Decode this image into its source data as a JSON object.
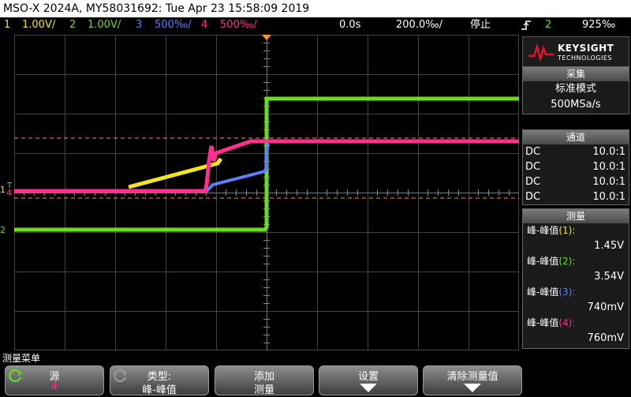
{
  "title": "MSO-X 2024A, MY58031692: Tue Apr 23 15:58:09 2019",
  "channels": {
    "ch1_num": "1",
    "ch1_scale": "1.00V/",
    "ch2_num": "2",
    "ch2_scale": "1.00V/",
    "ch3_num": "3",
    "ch3_scale": "500‰/",
    "ch4_num": "4",
    "ch4_scale": "500‰/",
    "time_delay": "0.0s",
    "timebase": "200.0‰/",
    "run_state": "停止",
    "trigger_icon": "trigger-edge-icon",
    "trigger_source": "2",
    "trigger_level": "925‰"
  },
  "logo": {
    "brand": "KEYSIGHT",
    "sub": "TECHNOLOGIES"
  },
  "acquisition": {
    "header": "采集",
    "mode": "标准模式",
    "rate": "500MSa/s"
  },
  "channel_panel": {
    "header": "通道",
    "rows": [
      {
        "coupling": "DC",
        "probe": "10.0:1",
        "color": "#f5e61c"
      },
      {
        "coupling": "DC",
        "probe": "10.0:1",
        "color": "#6bdc22"
      },
      {
        "coupling": "DC",
        "probe": "10.0:1",
        "color": "#5b7fff"
      },
      {
        "coupling": "DC",
        "probe": "10.0:1",
        "color": "#ff2f8e"
      }
    ]
  },
  "measure_panel": {
    "header": "测量",
    "items": [
      {
        "label": "峰-峰值",
        "ch": "(1):",
        "value": "1.45V",
        "color": "#f5e61c"
      },
      {
        "label": "峰-峰值",
        "ch": "(2):",
        "value": "3.54V",
        "color": "#6bdc22"
      },
      {
        "label": "峰-峰值",
        "ch": "(3):",
        "value": "740mV",
        "color": "#5b7fff"
      },
      {
        "label": "峰-峰值",
        "ch": "(4):",
        "value": "760mV",
        "color": "#ff2f8e"
      }
    ]
  },
  "markers": {
    "ch1": "1",
    "ch2": "2",
    "ch4": "4",
    "trig": "T"
  },
  "softkeys": {
    "menu_title": "测量菜单",
    "source_label": "源",
    "source_value": "4",
    "type_label": "类型:",
    "type_value": "峰-峰值",
    "add_label": "添加",
    "add_value": "测量",
    "settings_label": "设置",
    "clear_label": "清除测量值"
  },
  "colors": {
    "ch1": "#f5e61c",
    "ch2": "#6bdc22",
    "ch3": "#5b7fff",
    "ch4": "#ff2f8e",
    "cursor": "#ff8a6a"
  }
}
